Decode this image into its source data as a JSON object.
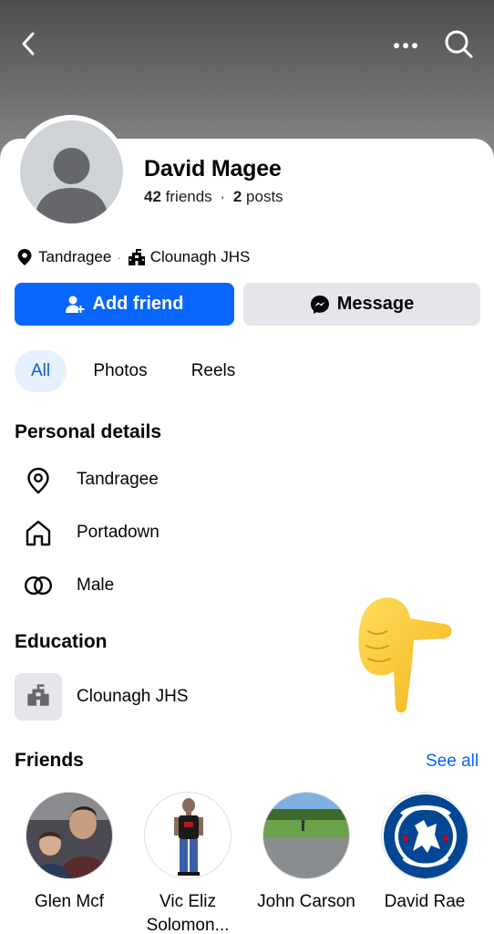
{
  "header": {
    "back_icon": "chevron-left-icon",
    "more_icon": "more-horizontal-icon",
    "search_icon": "search-icon"
  },
  "profile": {
    "name": "David Magee",
    "friends_count": "42",
    "friends_label": "friends",
    "separator": "·",
    "posts_count": "2",
    "posts_label": "posts",
    "location": "Tandragee",
    "school": "Clounagh JHS"
  },
  "actions": {
    "add_friend_label": "Add friend",
    "message_label": "Message",
    "add_color": "#0866ff"
  },
  "tabs": [
    {
      "label": "All",
      "selected": true
    },
    {
      "label": "Photos",
      "selected": false
    },
    {
      "label": "Reels",
      "selected": false
    }
  ],
  "personal_details": {
    "title": "Personal details",
    "items": [
      {
        "icon": "location-pin-icon",
        "label": "Tandragee"
      },
      {
        "icon": "home-icon",
        "label": "Portadown"
      },
      {
        "icon": "gender-rings-icon",
        "label": "Male"
      }
    ]
  },
  "education": {
    "title": "Education",
    "items": [
      {
        "icon": "school-icon",
        "label": "Clounagh JHS"
      }
    ]
  },
  "friends": {
    "title": "Friends",
    "see_all_label": "See all",
    "items": [
      {
        "name": "Glen Mcf"
      },
      {
        "name": "Vic Eliz Solomon..."
      },
      {
        "name": "John Carson"
      },
      {
        "name": "David Rae"
      }
    ]
  },
  "overlay": {
    "emoji": "pointing-down-hand-emoji"
  }
}
